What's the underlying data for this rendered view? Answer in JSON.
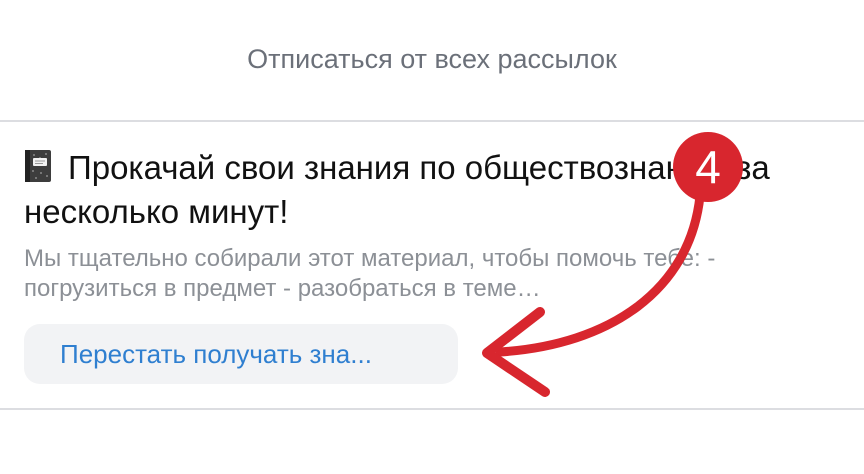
{
  "unsubscribe_all": {
    "label": "Отписаться от всех рассылок"
  },
  "newsletter": {
    "icon": "notebook-icon",
    "title": "Прокачай свои знания по обществознанию за несколько минут!",
    "description": "Мы тщательно собирали этот материал, чтобы помочь тебе: - погрузиться в предмет - разобраться в теме…",
    "unsubscribe_button": "Перестать получать зна..."
  },
  "annotation": {
    "step": "4",
    "color": "#d8262e"
  }
}
